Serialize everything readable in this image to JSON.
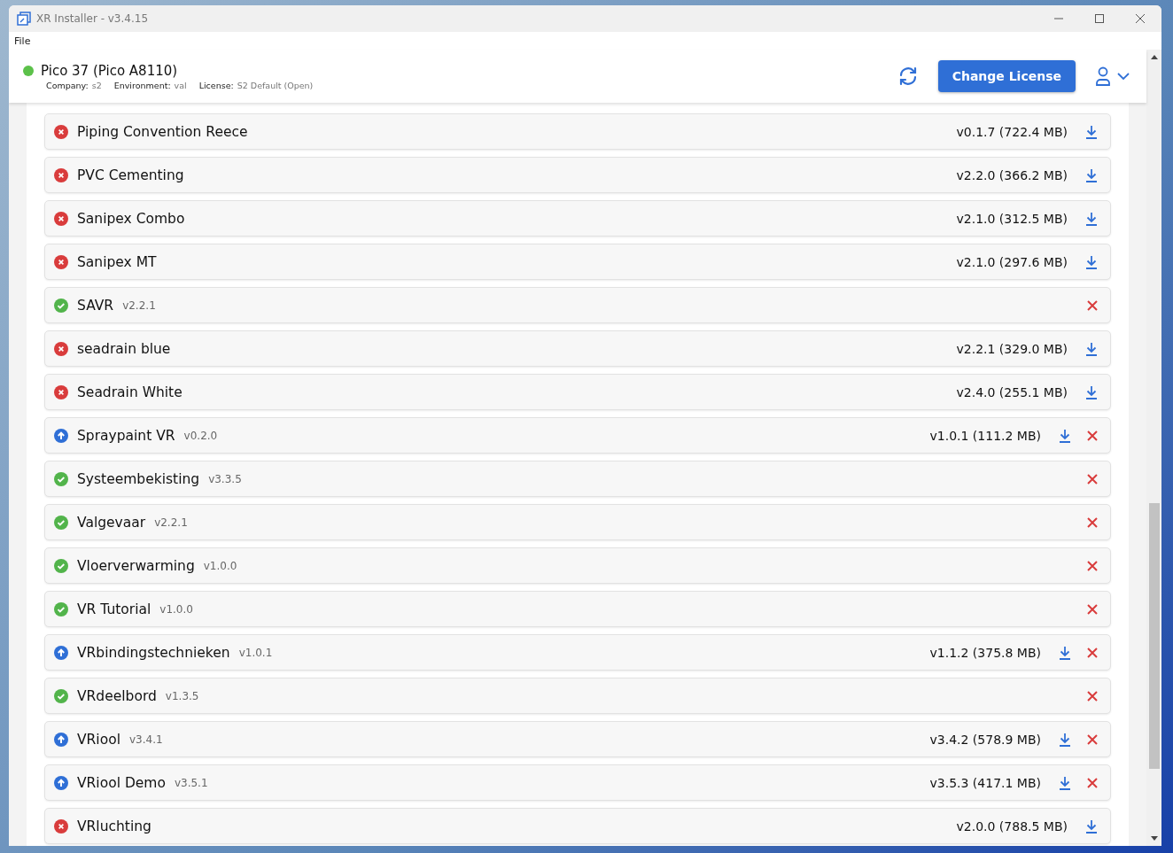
{
  "window": {
    "title": "XR Installer - v3.4.15"
  },
  "menu": [
    "File"
  ],
  "device": {
    "online": true,
    "name": "Pico 37 (Pico A8110)",
    "details": [
      {
        "label": "Company:",
        "value": "s2"
      },
      {
        "label": "Environment:",
        "value": "val"
      },
      {
        "label": "License:",
        "value": "S2 Default (Open)"
      }
    ]
  },
  "change_license_button": "Change License",
  "apps": [
    {
      "name": "Piping Convention Reece",
      "kind": "missing",
      "available": "v0.1.7 (722.4 MB)"
    },
    {
      "name": "PVC Cementing",
      "kind": "missing",
      "available": "v2.2.0 (366.2 MB)"
    },
    {
      "name": "Sanipex Combo",
      "kind": "missing",
      "available": "v2.1.0 (312.5 MB)"
    },
    {
      "name": "Sanipex MT",
      "kind": "missing",
      "available": "v2.1.0 (297.6 MB)"
    },
    {
      "name": "SAVR",
      "kind": "installed",
      "installed": "v2.2.1"
    },
    {
      "name": "seadrain blue",
      "kind": "missing",
      "available": "v2.2.1 (329.0 MB)"
    },
    {
      "name": "Seadrain White",
      "kind": "missing",
      "available": "v2.4.0 (255.1 MB)"
    },
    {
      "name": "Spraypaint VR",
      "kind": "update",
      "installed": "v0.2.0",
      "available": "v1.0.1 (111.2 MB)"
    },
    {
      "name": "Systeembekisting",
      "kind": "installed",
      "installed": "v3.3.5"
    },
    {
      "name": "Valgevaar",
      "kind": "installed",
      "installed": "v2.2.1"
    },
    {
      "name": "Vloerverwarming",
      "kind": "installed",
      "installed": "v1.0.0"
    },
    {
      "name": "VR Tutorial",
      "kind": "installed",
      "installed": "v1.0.0"
    },
    {
      "name": "VRbindingstechnieken",
      "kind": "update",
      "installed": "v1.0.1",
      "available": "v1.1.2 (375.8 MB)"
    },
    {
      "name": "VRdeelbord",
      "kind": "installed",
      "installed": "v1.3.5"
    },
    {
      "name": "VRiool",
      "kind": "update",
      "installed": "v3.4.1",
      "available": "v3.4.2 (578.9 MB)"
    },
    {
      "name": "VRiool Demo",
      "kind": "update",
      "installed": "v3.5.1",
      "available": "v3.5.3 (417.1 MB)"
    },
    {
      "name": "VRluchting",
      "kind": "missing",
      "available": "v2.0.0 (788.5 MB)"
    }
  ]
}
